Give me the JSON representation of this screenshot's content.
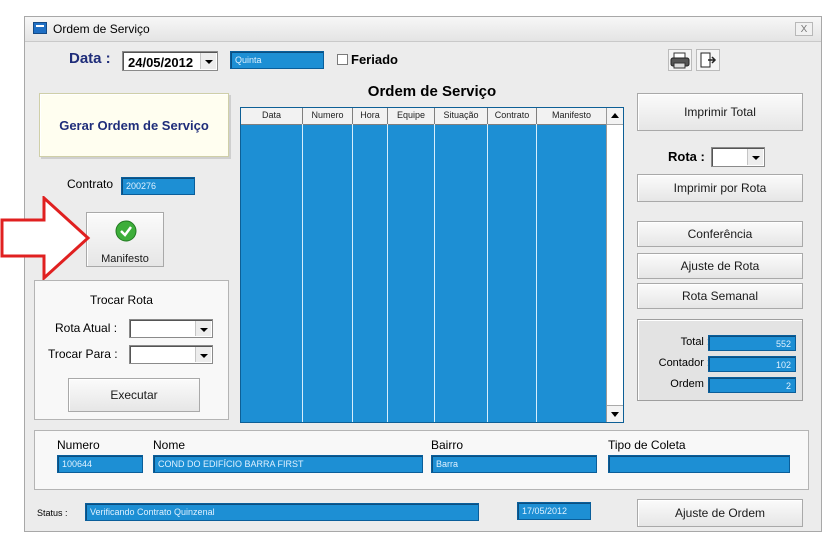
{
  "window": {
    "title": "Ordem de Serviço",
    "close": "X"
  },
  "topbar": {
    "date_label": "Data :",
    "date_value": "24/05/2012",
    "weekday": "Quinta",
    "holiday_label": "Feriado"
  },
  "left": {
    "gerar_label": "Gerar Ordem de Serviço",
    "contrato_label": "Contrato",
    "contrato_value": "200276",
    "manifesto_label": "Manifesto",
    "trocar": {
      "title": "Trocar Rota",
      "rota_atual_label": "Rota Atual :",
      "trocar_para_label": "Trocar Para :",
      "executar_label": "Executar"
    }
  },
  "grid": {
    "title": "Ordem de Serviço",
    "columns": [
      "Data",
      "Numero",
      "Hora",
      "Equipe",
      "Situação",
      "Contrato",
      "Manifesto"
    ]
  },
  "right": {
    "imprimir_total": "Imprimir Total",
    "rota_label": "Rota :",
    "imprimir_rota": "Imprimir por Rota",
    "conferencia": "Conferência",
    "ajuste_rota": "Ajuste de Rota",
    "rota_semanal": "Rota Semanal",
    "stats": [
      {
        "label": "Total :",
        "value": "552"
      },
      {
        "label": "Contador :",
        "value": "102"
      },
      {
        "label": "Ordem :",
        "value": "2"
      }
    ]
  },
  "details": {
    "numero_label": "Numero",
    "numero_value": "100644",
    "nome_label": "Nome",
    "nome_value": "COND DO EDIFÍCIO BARRA FIRST",
    "bairro_label": "Bairro",
    "bairro_value": "Barra",
    "tipo_label": "Tipo de Coleta",
    "tipo_value": ""
  },
  "statusbar": {
    "status_label": "Status :",
    "status_value": "Verificando Contrato Quinzenal",
    "date": "17/05/2012",
    "ajuste_ordem": "Ajuste de Ordem"
  },
  "colors": {
    "field_blue": "#1d8fd4",
    "arrow_red": "#e02020",
    "manifest_green": "#3dae3a"
  }
}
